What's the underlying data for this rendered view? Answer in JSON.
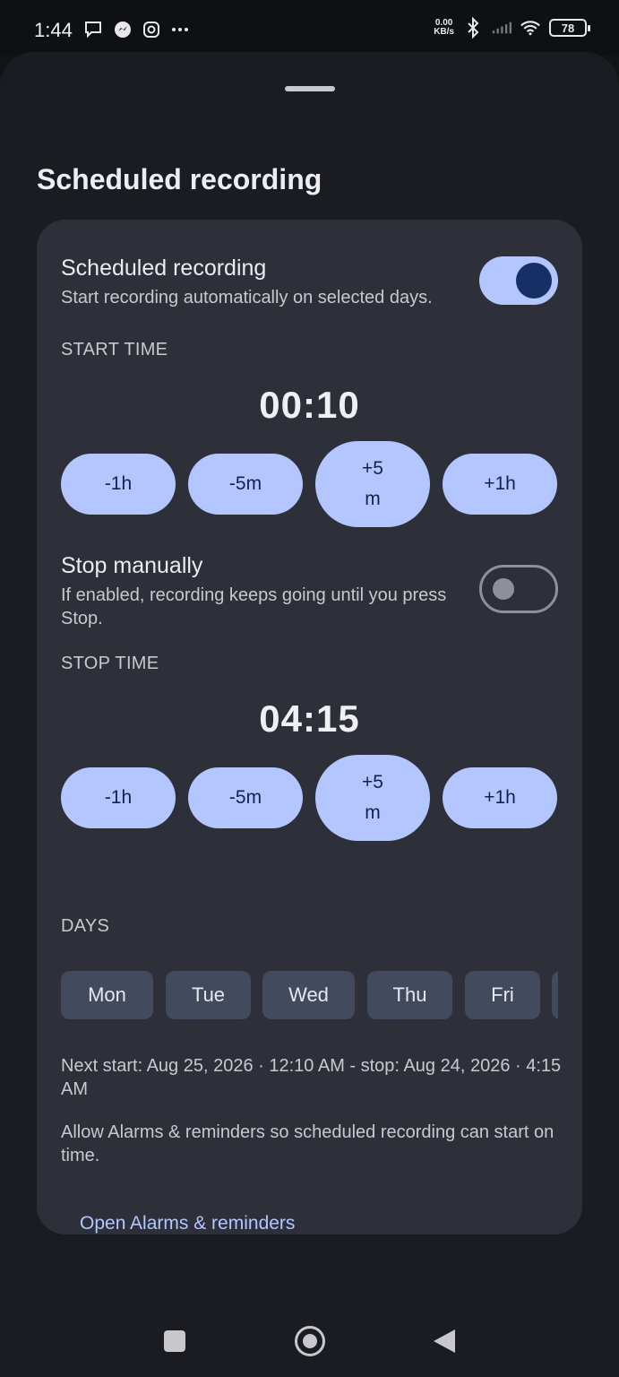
{
  "status_bar": {
    "time": "1:44",
    "net_speed_value": "0.00",
    "net_speed_unit": "KB/s",
    "battery": "78",
    "left_icons": [
      "chat-icon",
      "messenger-icon",
      "instagram-icon",
      "more-icon"
    ],
    "right_icons": [
      "bluetooth-icon",
      "signal-icon",
      "wifi-icon",
      "battery-icon"
    ]
  },
  "sheet": {
    "title": "Scheduled recording"
  },
  "scheduled": {
    "title": "Scheduled recording",
    "subtitle": "Start recording automatically on selected days.",
    "enabled": true
  },
  "start": {
    "label": "START TIME",
    "time": "00:10",
    "buttons": [
      "-1h",
      "-5m",
      "+5\nm",
      "+1h"
    ]
  },
  "stop_manually": {
    "title": "Stop manually",
    "subtitle": "If enabled, recording keeps going until you press Stop.",
    "enabled": false
  },
  "stop": {
    "label": "STOP TIME",
    "time": "04:15",
    "buttons": [
      "-1h",
      "-5m",
      "+5\nm",
      "+1h"
    ]
  },
  "days": {
    "label": "DAYS",
    "items": [
      "Mon",
      "Tue",
      "Wed",
      "Thu",
      "Fri",
      ""
    ]
  },
  "next_info": "Next start: Aug 25, 2026 · 12:10 AM - stop: Aug 24, 2026 · 4:15 AM",
  "alarm_note": "Allow Alarms & reminders so scheduled recording can start on time.",
  "alarm_link": "Open Alarms & reminders",
  "colors": {
    "accent": "#b4c6ff",
    "accent_dark": "#163066",
    "card": "#2e3039",
    "sheet": "#1b1c21"
  }
}
